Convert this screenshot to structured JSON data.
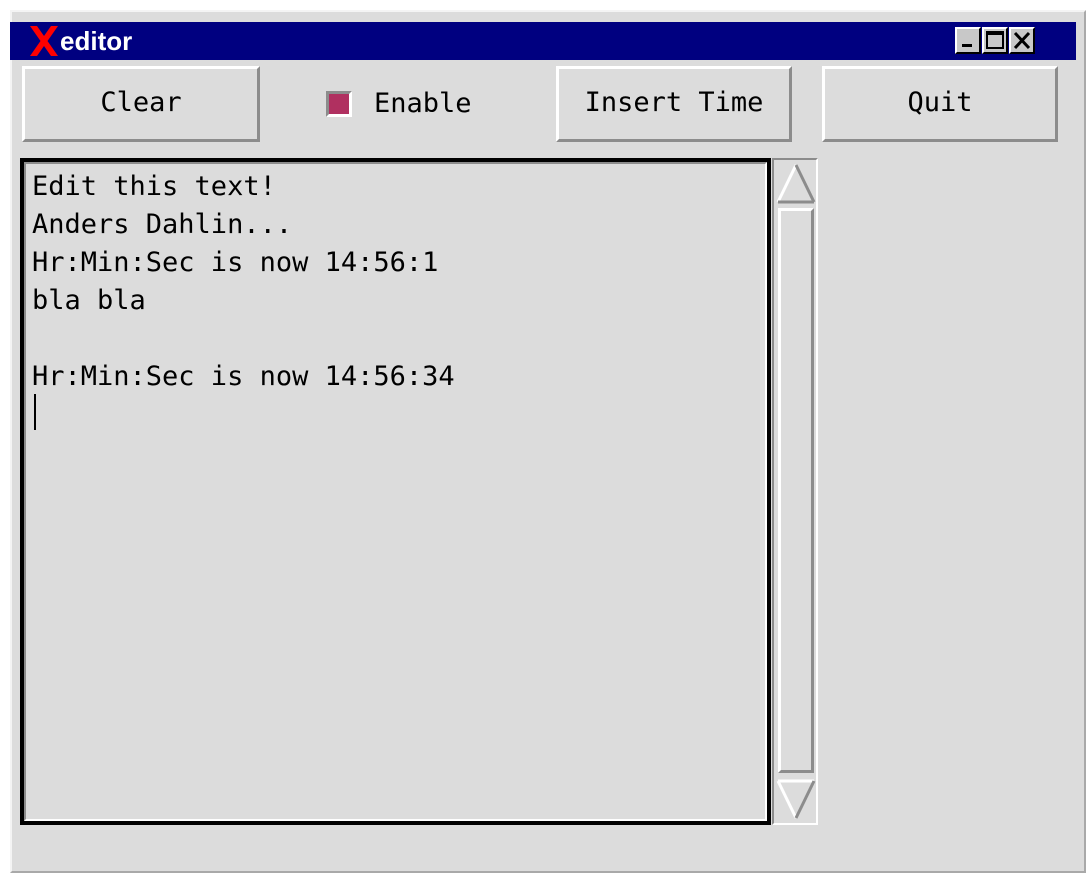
{
  "window": {
    "title": "editor",
    "title_bar_color": "#000080",
    "logo_icon": "x-logo-icon",
    "controls": {
      "minimize_icon": "minimize-icon",
      "maximize_icon": "maximize-icon",
      "close_icon": "close-icon"
    }
  },
  "toolbar": {
    "clear_label": "Clear",
    "enable_label": "Enable",
    "enable_checked": true,
    "enable_color": "#b03060",
    "insert_time_label": "Insert Time",
    "quit_label": "Quit"
  },
  "editor": {
    "lines": [
      "Edit this text!",
      "Anders Dahlin...",
      "Hr:Min:Sec is now 14:56:1",
      "bla bla",
      "",
      "Hr:Min:Sec is now 14:56:34"
    ]
  },
  "scrollbar": {
    "up_icon": "scroll-up-arrow-icon",
    "down_icon": "scroll-down-arrow-icon"
  }
}
